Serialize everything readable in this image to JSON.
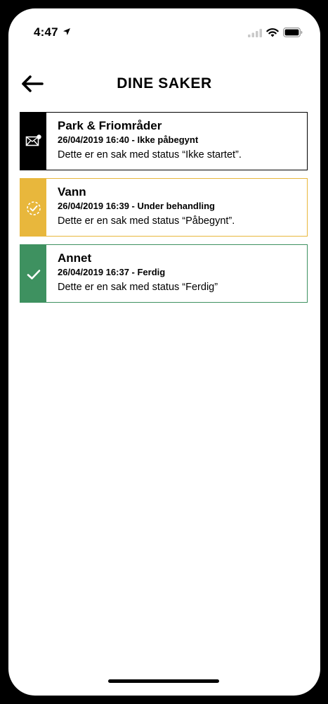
{
  "status_bar": {
    "time": "4:47"
  },
  "header": {
    "title": "DINE SAKER"
  },
  "cases": [
    {
      "title": "Park & Friområder",
      "meta": "26/04/2019 16:40 - Ikke påbegynt",
      "description": "Dette er en sak med status “Ikke startet”.",
      "status": "not-started",
      "status_icon": "envelope-icon",
      "color": "#000000"
    },
    {
      "title": "Vann",
      "meta": "26/04/2019 16:39 - Under behandling",
      "description": "Dette er en sak med status “Påbegynt”.",
      "status": "in-progress",
      "status_icon": "progress-check-icon",
      "color": "#E8B73C"
    },
    {
      "title": "Annet",
      "meta": "26/04/2019 16:37 - Ferdig",
      "description": "Dette er en sak med status “Ferdig”",
      "status": "done",
      "status_icon": "checkmark-icon",
      "color": "#3E9160"
    }
  ]
}
